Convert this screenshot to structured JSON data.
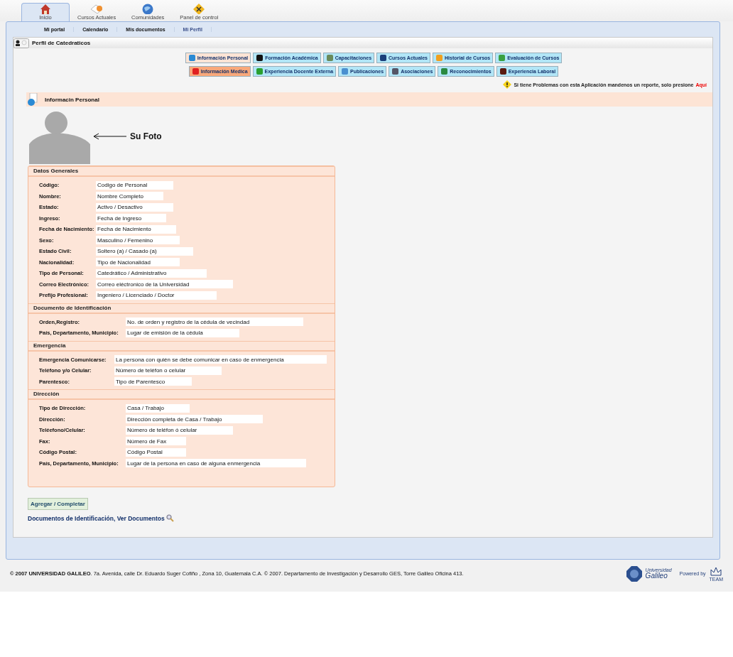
{
  "top_tabs": [
    {
      "label": "Inicio",
      "selected": true
    },
    {
      "label": "Cursos Actuales",
      "selected": false
    },
    {
      "label": "Comunidades",
      "selected": false
    },
    {
      "label": "Panel de control",
      "selected": false
    }
  ],
  "sub_nav": [
    {
      "label": "Mi portal",
      "selected": false
    },
    {
      "label": "Calendario",
      "selected": false
    },
    {
      "label": "Mis documentos",
      "selected": false
    },
    {
      "label": "Mi Perfil",
      "selected": true
    }
  ],
  "panel_title": "Perfil de Catedraticos",
  "section_rows": [
    [
      {
        "label": "Información Personal",
        "kind": "normal",
        "selected": true
      },
      {
        "label": "Formación Académica",
        "kind": "normal",
        "selected": false
      },
      {
        "label": "Capacitaciones",
        "kind": "normal",
        "selected": false
      },
      {
        "label": "Cursos Actuales",
        "kind": "normal",
        "selected": false
      },
      {
        "label": "Historial de Cursos",
        "kind": "normal",
        "selected": false
      },
      {
        "label": "Evaluación de Cursos",
        "kind": "normal",
        "selected": false
      }
    ],
    [
      {
        "label": "Información Medica",
        "kind": "alert",
        "selected": false
      },
      {
        "label": "Experiencia Docente Externa",
        "kind": "normal",
        "selected": false
      },
      {
        "label": "Publicaciones",
        "kind": "normal",
        "selected": false
      },
      {
        "label": "Asociaciones",
        "kind": "normal",
        "selected": false
      },
      {
        "label": "Reconocimientos",
        "kind": "normal",
        "selected": false
      },
      {
        "label": "Experiencia Laboral",
        "kind": "normal",
        "selected": false
      }
    ]
  ],
  "report_notice": {
    "text": "Si tiene Problemas con esta Aplicación mandenos un reporte, solo presione",
    "link": "Aquí"
  },
  "section_header": "Informacin Personal",
  "photo_label": "Su Foto",
  "form_sections": [
    {
      "title": "Datos Generales",
      "fields": [
        {
          "label": "Código:",
          "value": "Codigo de Personal"
        },
        {
          "label": "Nombre:",
          "value": "Nombre Completo"
        },
        {
          "label": "Estado:",
          "value": "Activo / Desactivo"
        },
        {
          "label": "Ingreso:",
          "value": "Fecha de Ingreso"
        },
        {
          "label": "Fecha de Nacimiento:",
          "value": "Fecha de Nacimiento"
        },
        {
          "label": "Sexo:",
          "value": "Masculino / Femenino"
        },
        {
          "label": "Estado Civil:",
          "value": "Soltero (a) / Casado (a)"
        },
        {
          "label": "Nacionalidad:",
          "value": "Tipo de Nacionalidad"
        },
        {
          "label": "Tipo de Personal:",
          "value": "Catedrático / Administrativo"
        },
        {
          "label": "Correo Electrónico:",
          "value": "Correo eléctronico de la Universidad"
        },
        {
          "label": "Prefijo Profesional:",
          "value": "Ingeniero / Licenciado / Doctor"
        }
      ]
    },
    {
      "title": "Documento de Identificación",
      "fields": [
        {
          "label": "Orden,Registro:",
          "value": "No. de orden y registro de la cédula de vecindad"
        },
        {
          "label": "País, Departamento, Municipio:",
          "value": "Lugar de emisión de la cédula"
        }
      ]
    },
    {
      "title": "Emergencia",
      "fields": [
        {
          "label": "Emergencia Comunicarse:",
          "value": "La persona con quién se debe comunicar en caso de enmergencia"
        },
        {
          "label": "Teléfono y/o Celular:",
          "value": "Número de teléfon o celular"
        },
        {
          "label": "Parentesco:",
          "value": "Tipo de Parentesco"
        }
      ]
    },
    {
      "title": "Dirección",
      "fields": [
        {
          "label": "Tipo de Dirección:",
          "value": "Casa / Trabajo"
        },
        {
          "label": "Dirección:",
          "value": "Dirección completa de Casa / Trabajo"
        },
        {
          "label": "Teléefono/Celular:",
          "value": "Número de teléfon ó celular"
        },
        {
          "label": "Fax:",
          "value": "Número de Fax"
        },
        {
          "label": "Código Postal:",
          "value": "Código Postal"
        },
        {
          "label": "País, Departamento, Municipio:",
          "value": "Lugar de la persona en caso de alguna enmergencia"
        }
      ]
    }
  ],
  "submit_button": "Agregar / Completar",
  "documents_link": "Documentos de Identificación, Ver Documentos",
  "footer": {
    "text": "**© 2007 UNIVERSIDAD GALILEO**. 7a. Avenida, calle Dr. Eduardo Suger Cofiño , Zona 10, Guatemala C.A. © 2007. Departamento de Investigación y Desarrollo GES, Torre Galileo Oficina 413.",
    "logo_line1": "Universidad",
    "logo_line2": "Galileo",
    "powered_by": "Powered by",
    "team": "TEAM"
  }
}
